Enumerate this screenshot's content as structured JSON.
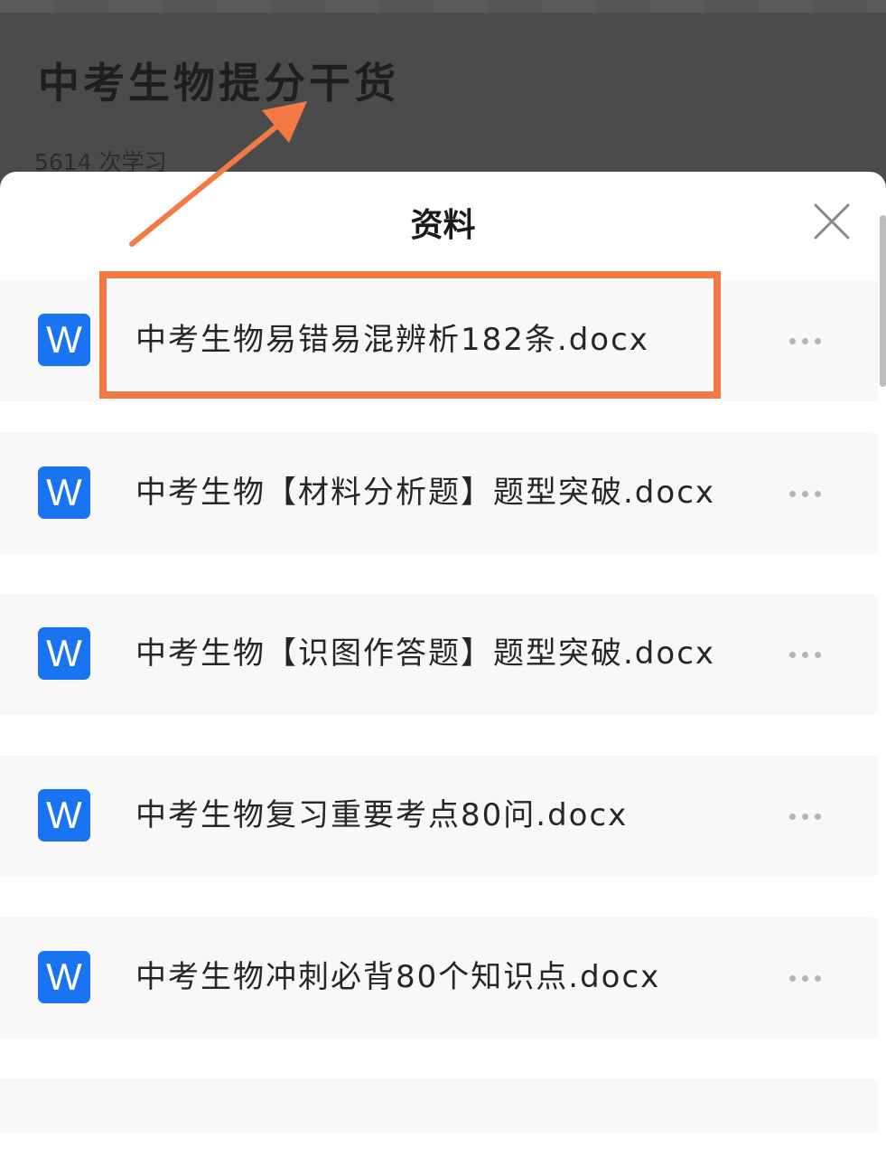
{
  "background_page": {
    "title": "中考生物提分干货",
    "study_count": "5614 次学习"
  },
  "sheet": {
    "title": "资料",
    "close_icon": "close-icon"
  },
  "files": [
    {
      "icon_letter": "W",
      "name": "中考生物易错易混辨析182条.docx"
    },
    {
      "icon_letter": "W",
      "name": "中考生物【材料分析题】题型突破.docx"
    },
    {
      "icon_letter": "W",
      "name": "中考生物【识图作答题】题型突破.docx"
    },
    {
      "icon_letter": "W",
      "name": "中考生物复习重要考点80问.docx"
    },
    {
      "icon_letter": "W",
      "name": "中考生物冲刺必背80个知识点.docx"
    }
  ],
  "colors": {
    "word_icon": "#1a74f2",
    "annotation": "#f47a45",
    "overlay_dim": "#4b4b4b"
  }
}
